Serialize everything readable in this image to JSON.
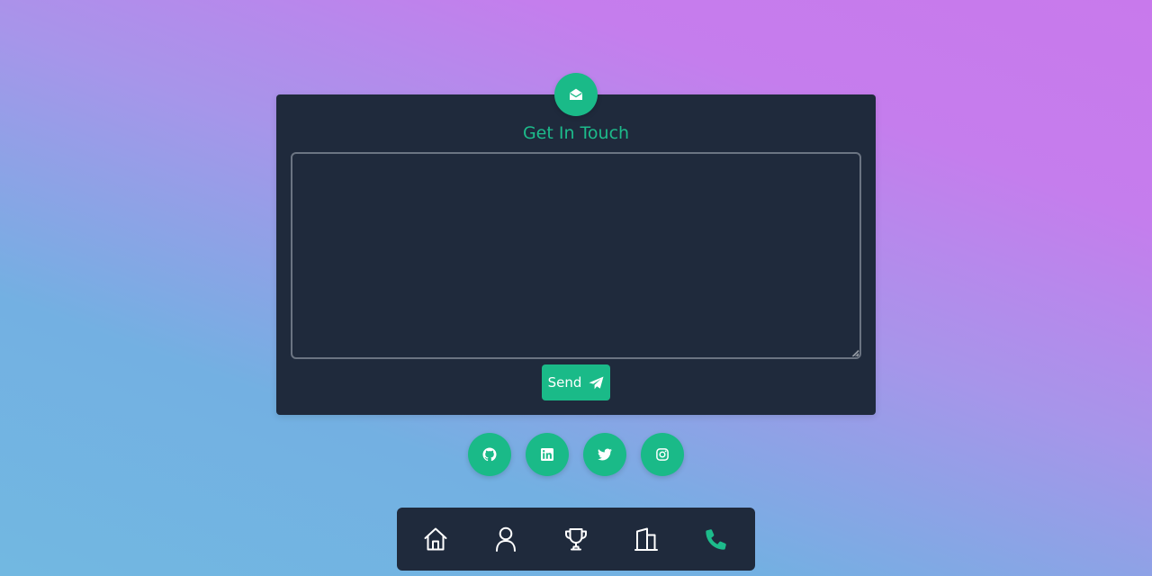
{
  "contact": {
    "title": "Get In Touch",
    "message_value": "",
    "message_placeholder": "",
    "send_label": "Send",
    "badge_icon": "envelope-open-icon",
    "send_icon": "paper-plane-icon"
  },
  "social": [
    {
      "name": "github",
      "icon": "github-icon"
    },
    {
      "name": "linkedin",
      "icon": "linkedin-icon"
    },
    {
      "name": "twitter",
      "icon": "twitter-icon"
    },
    {
      "name": "instagram",
      "icon": "instagram-icon"
    }
  ],
  "nav": {
    "items": [
      {
        "name": "home",
        "icon": "home-icon",
        "active": false
      },
      {
        "name": "about",
        "icon": "user-icon",
        "active": false
      },
      {
        "name": "achievements",
        "icon": "trophy-icon",
        "active": false
      },
      {
        "name": "experience",
        "icon": "building-icon",
        "active": false
      },
      {
        "name": "contact",
        "icon": "phone-icon",
        "active": true
      }
    ]
  },
  "colors": {
    "accent": "#1aba88",
    "card_bg": "#1f2a3c",
    "nav_icon": "#ffffff",
    "nav_icon_active": "#1dbb8b"
  }
}
